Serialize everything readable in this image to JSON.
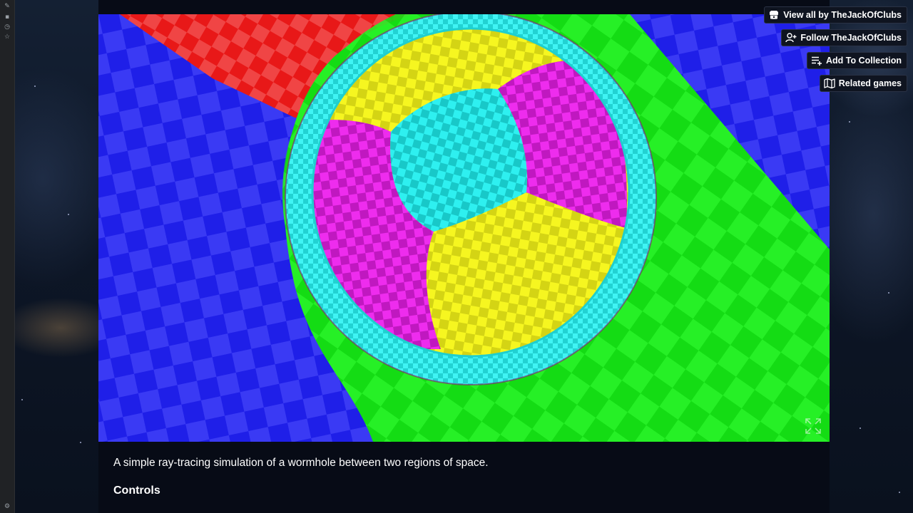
{
  "buttons": {
    "view_all": "View all by TheJackOfClubs",
    "follow": "Follow TheJackOfClubs",
    "add_collection": "Add To Collection",
    "related": "Related games"
  },
  "description": {
    "summary": "A simple ray-tracing simulation of a wormhole between two regions of space.",
    "controls_heading": "Controls"
  },
  "icons": {
    "view_all": "itch-logo-icon",
    "follow": "user-plus-icon",
    "add_collection": "playlist-add-icon",
    "related": "map-icon",
    "fullscreen": "fullscreen-icon"
  },
  "colors": {
    "blue_plane": "#2b2bf0",
    "red_plane": "#f02a2a",
    "green_tube": "#22ee22",
    "sphere_cyan": "#22e6e6",
    "sphere_yellow": "#eeee18",
    "sphere_magenta": "#e020e0",
    "page_background": "#070b16"
  }
}
